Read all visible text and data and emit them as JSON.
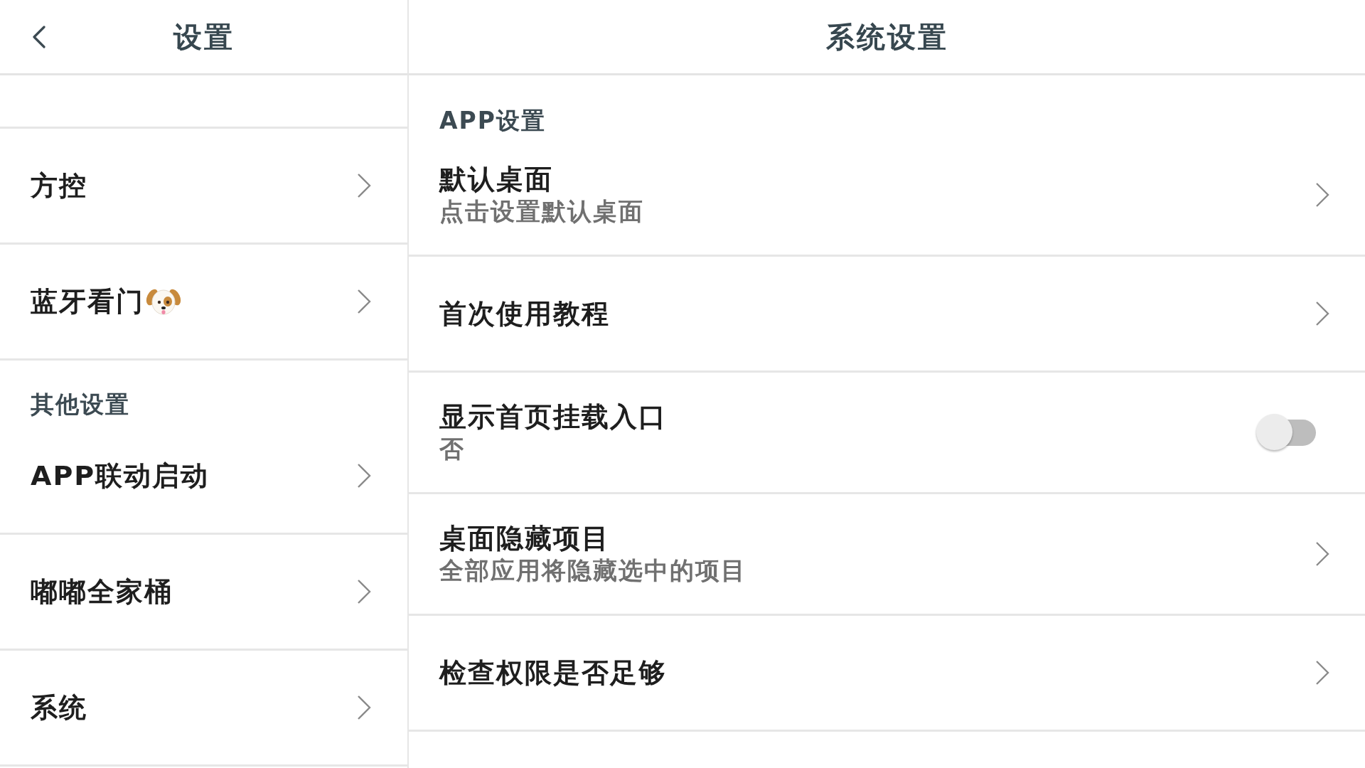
{
  "left": {
    "header": {
      "title": "设置"
    },
    "sections": [
      {
        "items": [
          {
            "kind": "plain",
            "label": "方控"
          },
          {
            "kind": "icon",
            "label": "蓝牙看门"
          }
        ]
      },
      {
        "title": "其他设置",
        "items": [
          {
            "kind": "plain",
            "label": "APP联动启动"
          },
          {
            "kind": "plain",
            "label": "嘟嘟全家桶"
          },
          {
            "kind": "plain",
            "label": "系统"
          }
        ]
      }
    ]
  },
  "right": {
    "header": {
      "title": "系统设置"
    },
    "sections": [
      {
        "title": "APP设置",
        "items": [
          {
            "kind": "link",
            "title": "默认桌面",
            "subtitle": "点击设置默认桌面"
          },
          {
            "kind": "link",
            "title": "首次使用教程"
          },
          {
            "kind": "switch",
            "title": "显示首页挂载入口",
            "subtitle": "否",
            "on": false
          },
          {
            "kind": "link",
            "title": "桌面隐藏项目",
            "subtitle": "全部应用将隐藏选中的项目"
          },
          {
            "kind": "link",
            "title": "检查权限是否足够"
          }
        ]
      }
    ]
  }
}
